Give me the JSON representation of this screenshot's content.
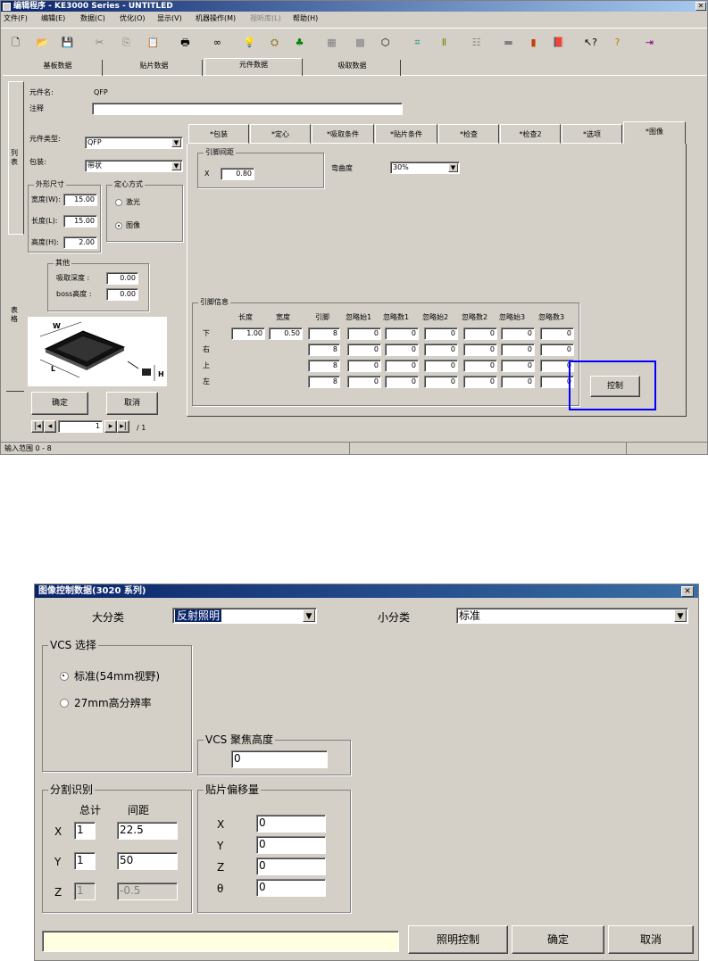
{
  "main": {
    "title": "编辑程序 - KE3000 Series - UNTITLED",
    "menu": [
      "文件(F)",
      "编辑(E)",
      "数据(C)",
      "优化(O)",
      "显示(V)",
      "机器操作(M)",
      "视听库(L)",
      "帮助(H)"
    ],
    "tabs": [
      "基板数据",
      "贴片数据",
      "元件数据",
      "吸取数据"
    ],
    "part_name_label": "元件名:",
    "part_name_value": "QFP",
    "note_label": "注释",
    "side_tab_top": "列表",
    "side_tab_bottom": "表格",
    "type_label": "元件类型:",
    "type_value": "QFP",
    "pack_label": "包装:",
    "pack_value": "带状",
    "size_group": "外形尺寸",
    "width_label": "宽度(W):",
    "width_value": "15.00",
    "length_label": "长度(L):",
    "length_value": "15.00",
    "height_label": "高度(H):",
    "height_value": "2.00",
    "center_group": "定心方式",
    "laser_label": "激光",
    "image_label": "图像",
    "other_group": "其他",
    "pick_depth_label": "吸取深度 :",
    "pick_depth_value": "0.00",
    "boss_label": "boss高度 :",
    "boss_value": "0.00",
    "ok": "确定",
    "cancel": "取消",
    "page_value": "1",
    "page_total": "/ 1",
    "sub_tabs": [
      "*包装",
      "*定心",
      "*吸取条件",
      "*贴片条件",
      "*检查",
      "*检查2",
      "*选项",
      "*图像"
    ],
    "lead_pitch_group": "引脚间距",
    "lead_pitch_label": "X",
    "lead_pitch_value": "0.80",
    "bend_label": "弯曲度",
    "bend_value": "30%",
    "lead_info_group": "引脚信息",
    "lead_headers": [
      "长度",
      "宽度",
      "引脚",
      "忽略始1",
      "忽略数1",
      "忽略始2",
      "忽略数2",
      "忽略始3",
      "忽略数3"
    ],
    "lead_rows": [
      {
        "side": "下",
        "cells": [
          "1.00",
          "0.50",
          "8",
          "0",
          "0",
          "0",
          "0",
          "0",
          "0"
        ]
      },
      {
        "side": "右",
        "cells": [
          "",
          "",
          "8",
          "0",
          "0",
          "0",
          "0",
          "0",
          "0"
        ]
      },
      {
        "side": "上",
        "cells": [
          "",
          "",
          "8",
          "0",
          "0",
          "0",
          "0",
          "0",
          "0"
        ]
      },
      {
        "side": "左",
        "cells": [
          "",
          "",
          "8",
          "0",
          "0",
          "0",
          "0",
          "0",
          "0"
        ]
      }
    ],
    "control_btn": "控制",
    "status": "输入范围 0 - 8",
    "figure_labels": {
      "w": "W",
      "l": "L",
      "h": "H"
    },
    "highlight_color": "#0000ff"
  },
  "dialog": {
    "title": "图像控制数据(3020 系列)",
    "major_label": "大分类",
    "major_value": "反射照明",
    "minor_label": "小分类",
    "minor_value": "标准",
    "vcs_group": "VCS 选择",
    "vcs_opt1": "标准(54mm视野)",
    "vcs_opt2": "27mm高分辨率",
    "focus_group": "VCS 聚焦高度",
    "focus_value": "0",
    "split_group": "分割识别",
    "total_label": "总计",
    "pitch_label": "间距",
    "x_label": "X",
    "x_total": "1",
    "x_pitch": "22.5",
    "y_label": "Y",
    "y_total": "1",
    "y_pitch": "50",
    "z_label": "Z",
    "z_total": "1",
    "z_pitch": "-0.5",
    "offset_group": "贴片偏移量",
    "off_x_label": "X",
    "off_x": "0",
    "off_y_label": "Y",
    "off_y": "0",
    "off_z_label": "Z",
    "off_z": "0",
    "off_t_label": "θ",
    "off_t": "0",
    "light_btn": "照明控制",
    "ok": "确定",
    "cancel": "取消",
    "status_fill": "#ffffe1"
  }
}
